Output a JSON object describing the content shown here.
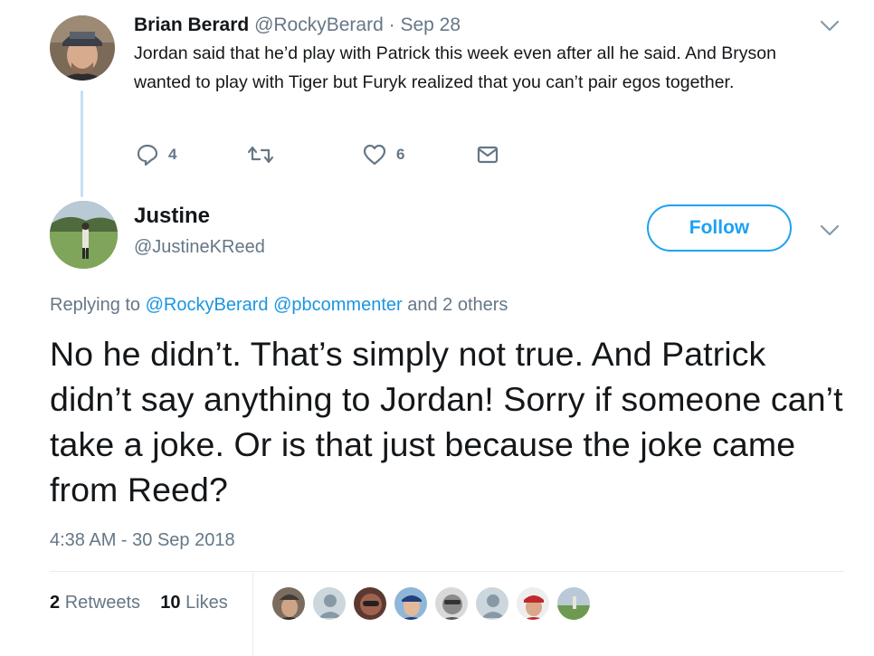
{
  "parent_tweet": {
    "name": "Brian Berard",
    "handle": "@RockyBerard",
    "separator": "·",
    "date": "Sep 28",
    "text": "Jordan said that he’d play with Patrick this week even after all he said.  And Bryson wanted to play with Tiger but Furyk realized that you can’t pair egos together.",
    "actions": {
      "replies": "4",
      "retweets": "",
      "likes": "6"
    },
    "icons": [
      "reply-icon",
      "retweet-icon",
      "heart-icon",
      "mail-icon",
      "chevron-down-icon"
    ]
  },
  "reply_tweet": {
    "name": "Justine",
    "handle": "@JustineKReed",
    "follow_label": "Follow",
    "replying_prefix": "Replying to",
    "replying_user1": "@RockyBerard",
    "replying_user2": "@pbcommenter",
    "replying_suffix": "and 2 others",
    "text": "No he didn’t. That’s simply not true. And Patrick didn’t say anything to Jordan! Sorry if someone can’t take a joke. Or is that just because the joke came from Reed?",
    "timestamp": "4:38 AM - 30 Sep 2018",
    "retweets_count": "2",
    "retweets_label": "Retweets",
    "likes_count": "10",
    "likes_label": "Likes"
  },
  "colors": {
    "accent": "#1da1f2",
    "link": "#1b95e0",
    "muted": "#657786",
    "thread_line": "#c4e0f6",
    "divider": "#e6ecf0"
  }
}
